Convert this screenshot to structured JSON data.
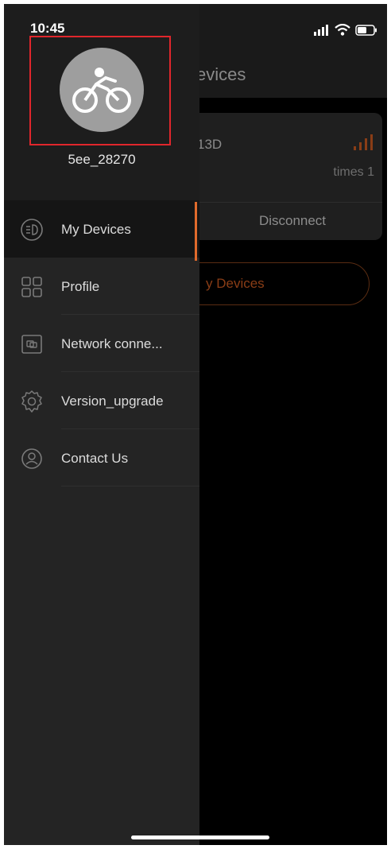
{
  "status_bar": {
    "time": "10:45"
  },
  "background_screen": {
    "title": "evices",
    "device_card": {
      "name": "13D",
      "times": "times 1",
      "disconnect_label": "Disconnect"
    },
    "add_button_label": "y Devices"
  },
  "drawer": {
    "username": "5ee_28270",
    "items": [
      {
        "label": "My Devices",
        "icon": "headlight-icon",
        "active": true
      },
      {
        "label": "Profile",
        "icon": "grid-icon",
        "active": false
      },
      {
        "label": "Network conne...",
        "icon": "network-card-icon",
        "active": false
      },
      {
        "label": "Version_upgrade",
        "icon": "gear-icon",
        "active": false
      },
      {
        "label": "Contact Us",
        "icon": "user-circle-icon",
        "active": false
      }
    ]
  },
  "colors": {
    "accent": "#e06a2c",
    "highlight_box": "#e0262c",
    "drawer_bg": "#242424"
  }
}
